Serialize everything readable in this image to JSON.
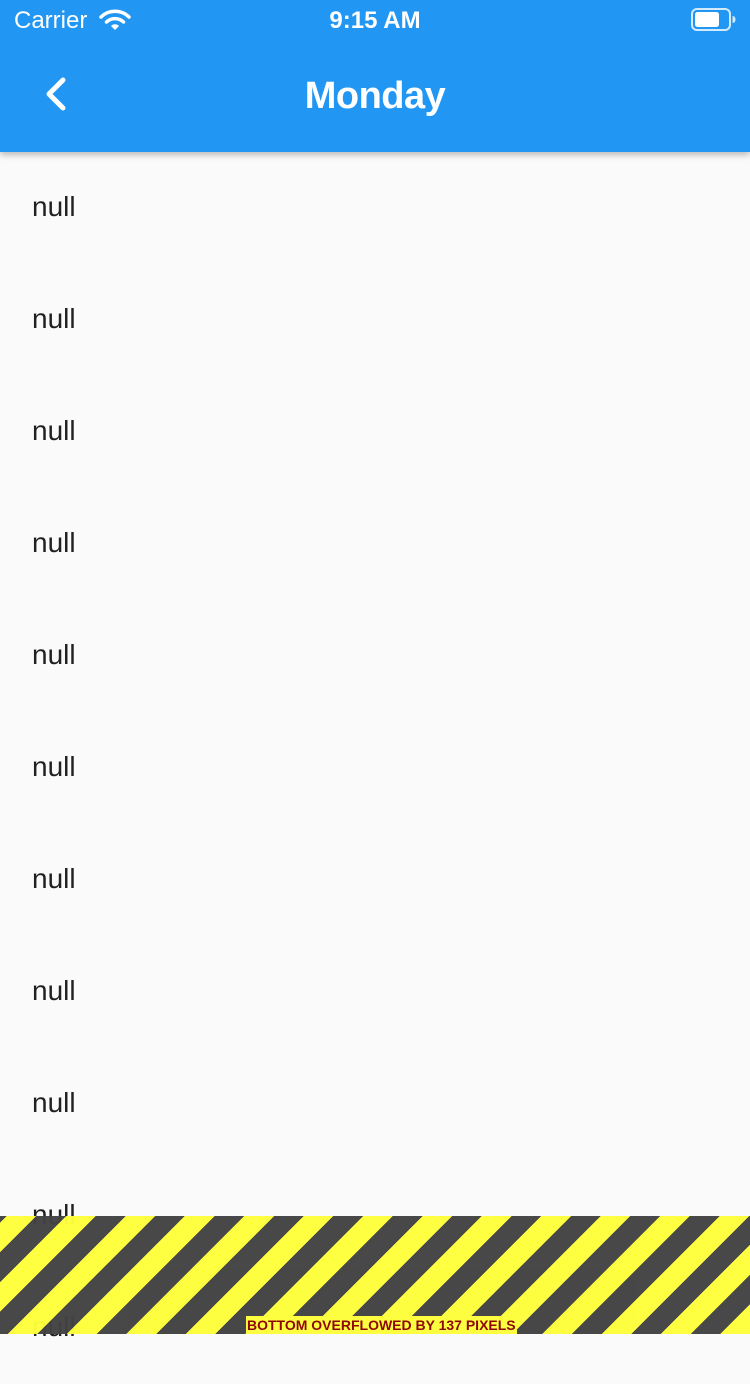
{
  "status_bar": {
    "carrier": "Carrier",
    "time": "9:15 AM",
    "wifi_icon": "wifi-icon",
    "battery_icon": "battery-icon"
  },
  "app_bar": {
    "title": "Monday",
    "back_icon": "chevron-left-icon",
    "background_color": "#2196F3",
    "text_color": "#FFFFFF"
  },
  "list": {
    "items": [
      {
        "label": "null"
      },
      {
        "label": "null"
      },
      {
        "label": "null"
      },
      {
        "label": "null"
      },
      {
        "label": "null"
      },
      {
        "label": "null"
      },
      {
        "label": "null"
      },
      {
        "label": "null"
      },
      {
        "label": "null"
      },
      {
        "label": "null"
      },
      {
        "label": "null"
      }
    ]
  },
  "overflow_warning": {
    "text": "BOTTOM OVERFLOWED BY 137 PIXELS",
    "stripe_colors": [
      "#FFFF3B",
      "#424242"
    ],
    "text_color": "#8B0000"
  }
}
